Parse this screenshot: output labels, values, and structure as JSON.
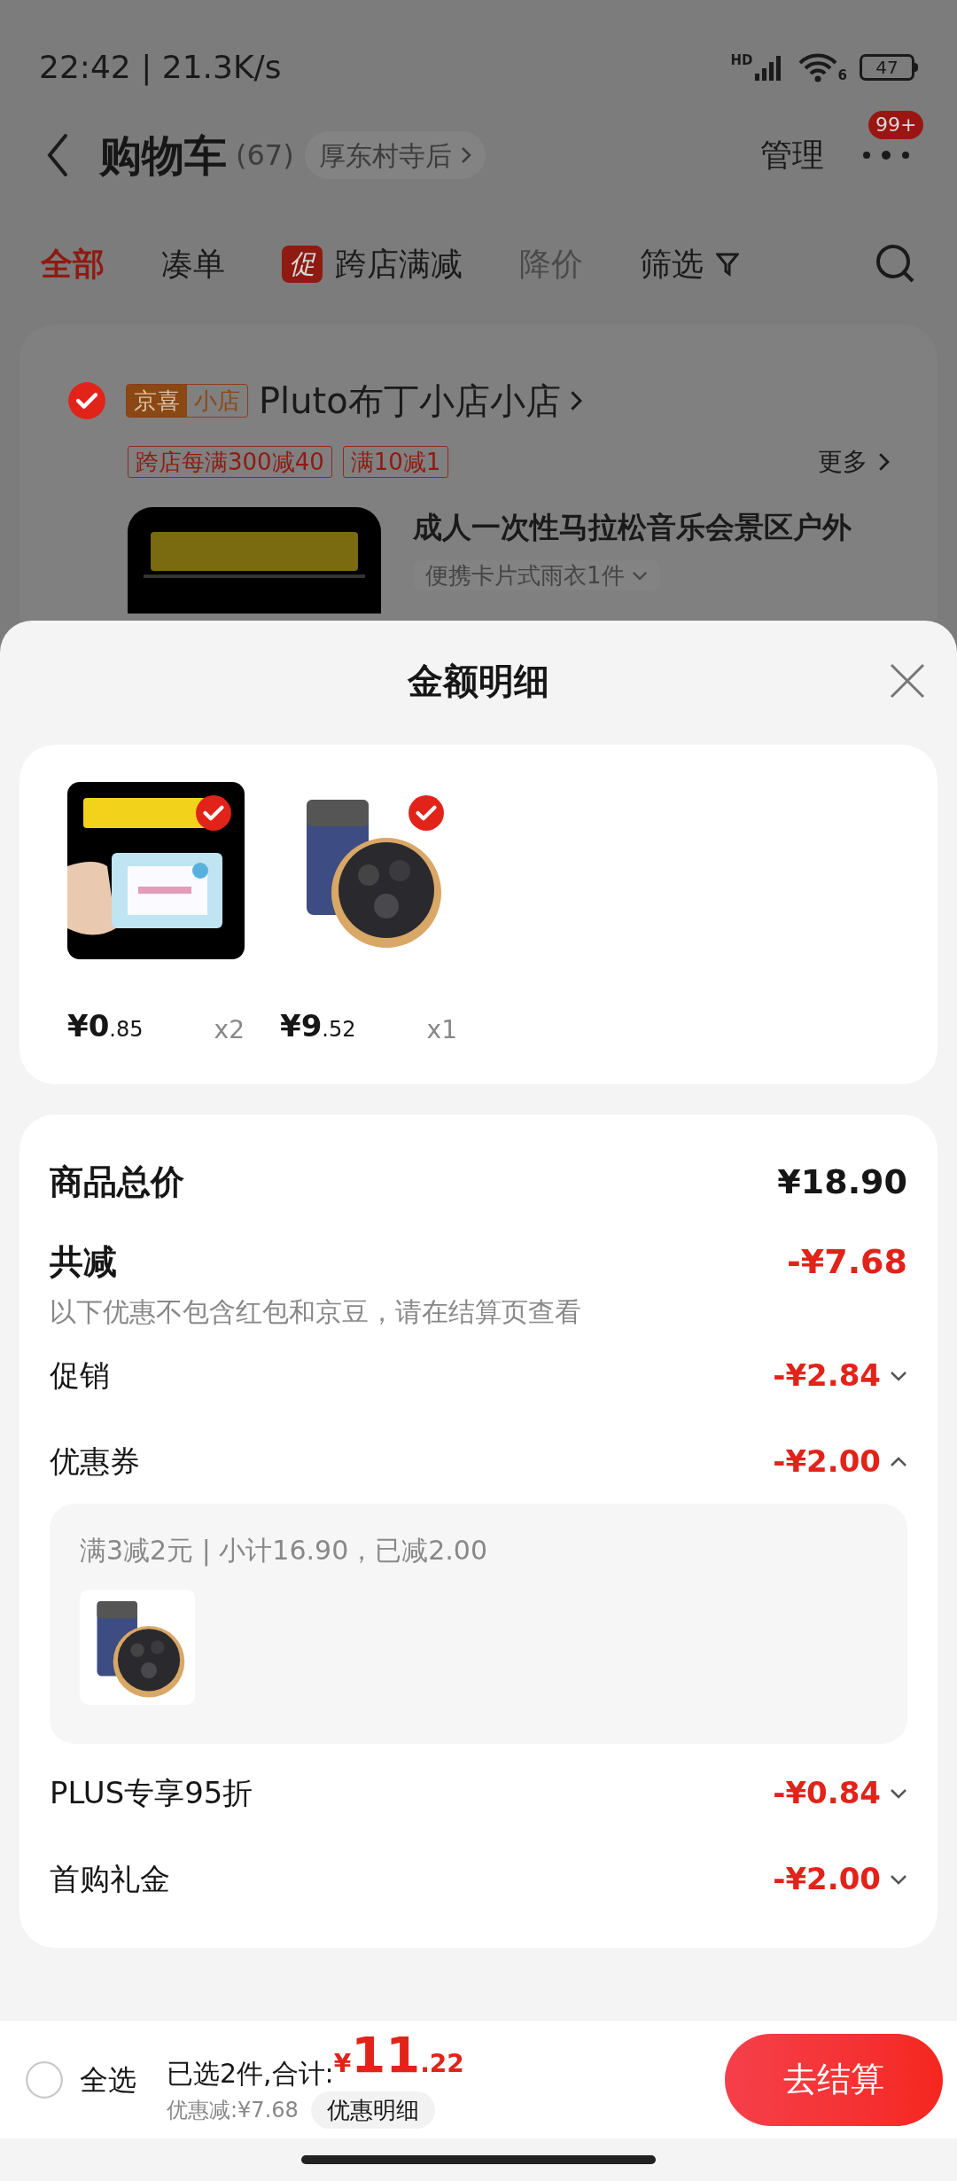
{
  "status_bar": {
    "time": "22:42 | 21.3K/s",
    "network": "HD",
    "wifi": "6",
    "battery": "47"
  },
  "header": {
    "title": "购物车",
    "count": "(67)",
    "location": "厚东村寺后",
    "manage": "管理",
    "badge": "99+"
  },
  "tabs": [
    {
      "label": "全部",
      "selected": true,
      "disabled": false
    },
    {
      "label": "凑单",
      "selected": false,
      "disabled": false
    },
    {
      "label": "跨店满减",
      "selected": false,
      "disabled": false,
      "promo": "促"
    },
    {
      "label": "降价",
      "selected": false,
      "disabled": true
    },
    {
      "label": "筛选",
      "selected": false,
      "disabled": false,
      "kind": "filter"
    }
  ],
  "store": {
    "checked": true,
    "tag": "京喜",
    "tag_sub": "小店",
    "name": "Pluto布丁小店小店",
    "promos": [
      "跨店每满300减40",
      "满10减1"
    ],
    "more": "更多",
    "product_title": "成人一次性马拉松音乐会景区户外",
    "variant": "便携卡片式雨衣1件"
  },
  "sheet": {
    "title": "金额明细",
    "items": [
      {
        "kind": "raincoat",
        "selected": true,
        "price": "¥0",
        "cents": ".85",
        "qty": "x2"
      },
      {
        "kind": "berries",
        "selected": true,
        "price": "¥9",
        "cents": ".52",
        "qty": "x1"
      }
    ],
    "rows": [
      {
        "kind": "total",
        "label": "商品总价",
        "amount": "¥18.90"
      },
      {
        "kind": "reduce",
        "label": "共减",
        "amount": "-¥7.68",
        "note": "以下优惠不包含红包和京豆，请在结算页查看"
      },
      {
        "kind": "item",
        "label": "促销",
        "amount": "-¥2.84",
        "expanded": false
      },
      {
        "kind": "item",
        "label": "优惠券",
        "amount": "-¥2.00",
        "expanded": true,
        "detail": "满3减2元 | 小计16.90，已减2.00"
      },
      {
        "kind": "item",
        "label": "PLUS专享95折",
        "amount": "-¥0.84",
        "expanded": false
      },
      {
        "kind": "item",
        "label": "首购礼金",
        "amount": "-¥2.00",
        "expanded": false
      }
    ]
  },
  "bottom_bar": {
    "select_all": {
      "label": "全选",
      "checked": false
    },
    "summary": "已选2件,合计:",
    "currency": "¥",
    "amount": "11",
    "cents": ".22",
    "discount": "优惠减:¥7.68",
    "detail_button": "优惠明细",
    "checkout": "去结算"
  }
}
